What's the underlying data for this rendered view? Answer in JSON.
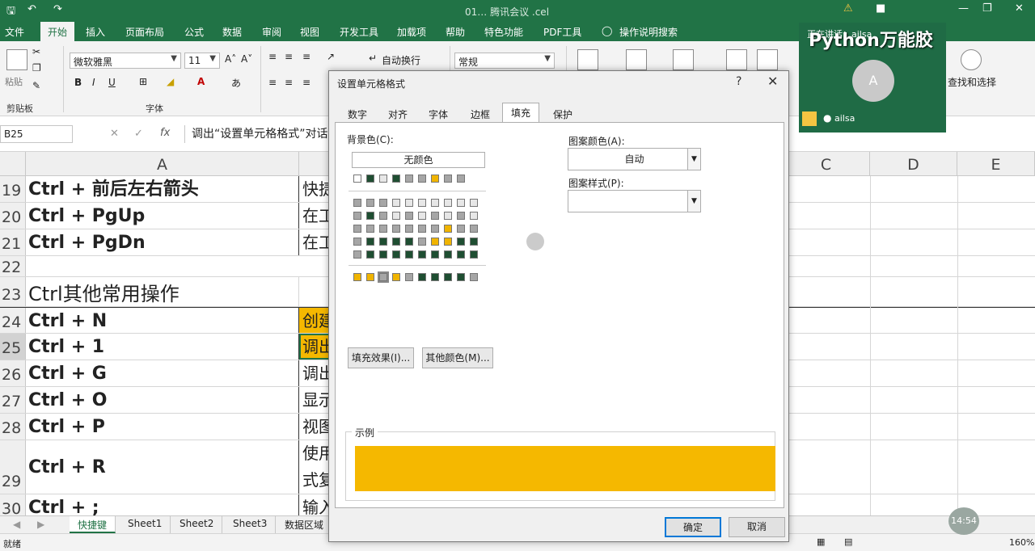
{
  "titlebar": {
    "title": "01… 腾讯会议 .cel",
    "save_icon": "save-icon",
    "undo_icon": "undo-icon"
  },
  "ribbon_tabs": [
    "文件",
    "开始",
    "插入",
    "页面布局",
    "公式",
    "数据",
    "审阅",
    "视图",
    "开发工具",
    "加载项",
    "帮助",
    "特色功能",
    "PDF工具",
    "操作说明搜索"
  ],
  "ribbon": {
    "paste": "粘贴",
    "clipboard": "剪贴板",
    "font_name": "微软雅黑",
    "font_size": "11",
    "font_group": "字体",
    "wrap_text": "自动换行",
    "number_format": "常规",
    "find_select": "查找和选择",
    "bold": "B",
    "italic": "I",
    "underline": "U"
  },
  "formula_bar": {
    "name_box": "B25",
    "fx": "fx",
    "content": "调出“设置单元格格式”对话"
  },
  "columns": [
    "A",
    "C",
    "D",
    "E"
  ],
  "rows": [
    {
      "num": "19",
      "a": "Ctrl + 前后左右箭头",
      "b": "快捷"
    },
    {
      "num": "20",
      "a": "Ctrl + PgUp",
      "b": "在工"
    },
    {
      "num": "21",
      "a": "Ctrl + PgDn",
      "b": "在工"
    },
    {
      "num": "22",
      "a": "",
      "b": ""
    },
    {
      "num": "23",
      "a": "Ctrl其他常用操作",
      "b": ""
    },
    {
      "num": "24",
      "a": "Ctrl + N",
      "b": "创建"
    },
    {
      "num": "25",
      "a": "Ctrl + 1",
      "b": "调出"
    },
    {
      "num": "26",
      "a": "Ctrl + G",
      "b": "调出"
    },
    {
      "num": "27",
      "a": "Ctrl + O",
      "b": "显示"
    },
    {
      "num": "28",
      "a": "Ctrl + P",
      "b": "视图"
    },
    {
      "num": "29",
      "a": "Ctrl + R",
      "b": "使用",
      "b2": "式复"
    },
    {
      "num": "30",
      "a": "Ctrl + ;",
      "b": "输入"
    }
  ],
  "sheet_tabs": [
    "快捷键",
    "Sheet1",
    "Sheet2",
    "Sheet3",
    "数据区域"
  ],
  "status": {
    "ready": "就绪",
    "zoom": "160%"
  },
  "video": {
    "name": "ailsa",
    "avatar_letter": "A",
    "top_text": "正在讲话：ailsa"
  },
  "watermark": "Python万能胶",
  "timer": "14:54",
  "dialog": {
    "title": "设置单元格格式",
    "help": "?",
    "close": "✕",
    "tabs": [
      "数字",
      "对齐",
      "字体",
      "边框",
      "填充",
      "保护"
    ],
    "active_tab": "填充",
    "bg_color_label": "背景色(C):",
    "no_color": "无颜色",
    "pattern_color_label": "图案颜色(A):",
    "pattern_color_value": "自动",
    "pattern_style_label": "图案样式(P):",
    "fill_effects": "填充效果(I)...",
    "more_colors": "其他颜色(M)...",
    "sample_label": "示例",
    "ok": "确定",
    "cancel": "取消"
  },
  "colors": {
    "excel_green": "#217346",
    "swatch_dark": "#1f4e32",
    "swatch_gray": "#a6a6a6",
    "swatch_gold": "#f0b400",
    "sample_fill": "#f5b800",
    "highlight_cell": "#f5b800",
    "pale": "#e7e7e7"
  }
}
